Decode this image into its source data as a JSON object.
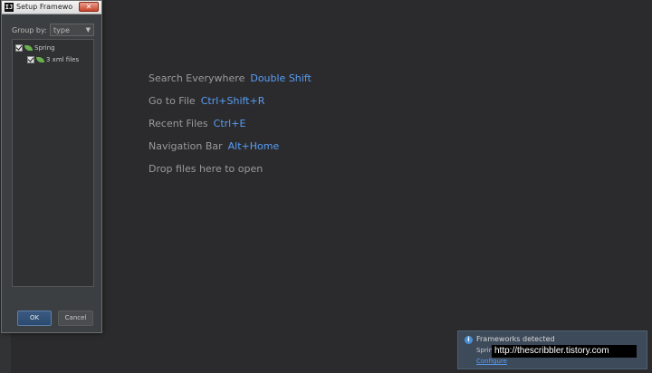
{
  "editor_hints": [
    {
      "label": "Search Everywhere",
      "key": "Double Shift"
    },
    {
      "label": "Go to File",
      "key": "Ctrl+Shift+R"
    },
    {
      "label": "Recent Files",
      "key": "Ctrl+E"
    },
    {
      "label": "Navigation Bar",
      "key": "Alt+Home"
    },
    {
      "label": "Drop files here to open",
      "key": ""
    }
  ],
  "dialog": {
    "app_icon_text": "IJ",
    "title": "Setup Frameworks",
    "close_symbol": "✕",
    "group_by_label": "Group by:",
    "group_by_value": "type",
    "tree": [
      {
        "label": "Spring",
        "checked": true
      },
      {
        "label": "3 xml files",
        "checked": true
      }
    ],
    "ok_label": "OK",
    "cancel_label": "Cancel"
  },
  "notification": {
    "icon": "info-icon",
    "title": "Frameworks detected",
    "body": "Spring",
    "link": "Configure"
  },
  "watermark": "http://thescribbler.tistory.com",
  "colors": {
    "background": "#2b2b2d",
    "accent": "#589df6",
    "leaf": "#6ab04c"
  }
}
